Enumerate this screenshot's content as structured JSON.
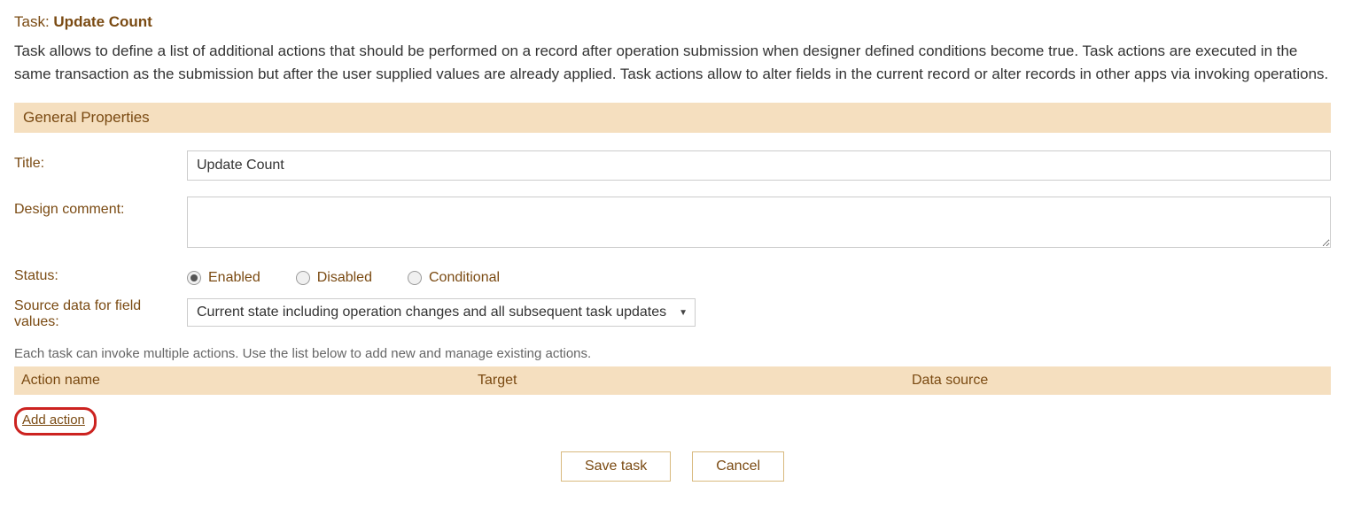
{
  "header": {
    "task_prefix": "Task: ",
    "task_name": "Update Count"
  },
  "description": "Task allows to define a list of additional actions that should be performed on a record after operation submission when designer defined conditions become true. Task actions are executed in the same transaction as the submission but after the user supplied values are already applied. Task actions allow to alter fields in the current record or alter records in other apps via invoking operations.",
  "section": {
    "general_properties": "General Properties"
  },
  "form": {
    "title_label": "Title:",
    "title_value": "Update Count",
    "design_comment_label": "Design comment:",
    "design_comment_value": "",
    "status_label": "Status:",
    "status_options": {
      "enabled": "Enabled",
      "disabled": "Disabled",
      "conditional": "Conditional"
    },
    "status_selected": "enabled",
    "source_data_label": "Source data for field values:",
    "source_data_value": "Current state including operation changes and all subsequent task updates"
  },
  "help": "Each task can invoke multiple actions. Use the list below to add new and manage existing actions.",
  "actions_table": {
    "columns": {
      "action_name": "Action name",
      "target": "Target",
      "data_source": "Data source"
    },
    "rows": []
  },
  "links": {
    "add_action": "Add action"
  },
  "buttons": {
    "save": "Save task",
    "cancel": "Cancel"
  }
}
